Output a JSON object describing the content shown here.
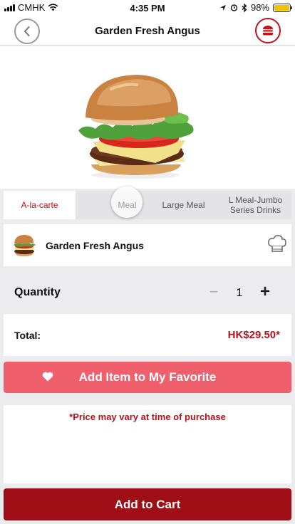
{
  "status_bar": {
    "carrier": "CMHK",
    "time": "4:35 PM",
    "battery": "98%",
    "battery_level": 0.98
  },
  "header": {
    "title": "Garden Fresh Angus",
    "back_icon": "chevron-left-icon",
    "menu_icon": "burger-menu-icon"
  },
  "tabs": [
    {
      "label": "A-la-carte",
      "active": true
    },
    {
      "label": "Meal",
      "active": false
    },
    {
      "label": "Large Meal",
      "active": false
    },
    {
      "label": "L Meal-Jumbo Series Drinks",
      "active": false
    }
  ],
  "product": {
    "name": "Garden Fresh Angus",
    "customize_icon": "chef-hat-icon"
  },
  "quantity": {
    "label": "Quantity",
    "value": "1",
    "minus": "−",
    "plus": "+"
  },
  "total": {
    "label": "Total:",
    "value": "HK$29.50*"
  },
  "favorite": {
    "label": "Add Item to My Favorite",
    "icon": "heart-icon"
  },
  "note": "*Price may vary at time of purchase",
  "cart": {
    "label": "Add to Cart"
  },
  "colors": {
    "brand_red": "#b5121b",
    "favorite_pink": "#f0606c",
    "cart_red": "#a00e15"
  }
}
